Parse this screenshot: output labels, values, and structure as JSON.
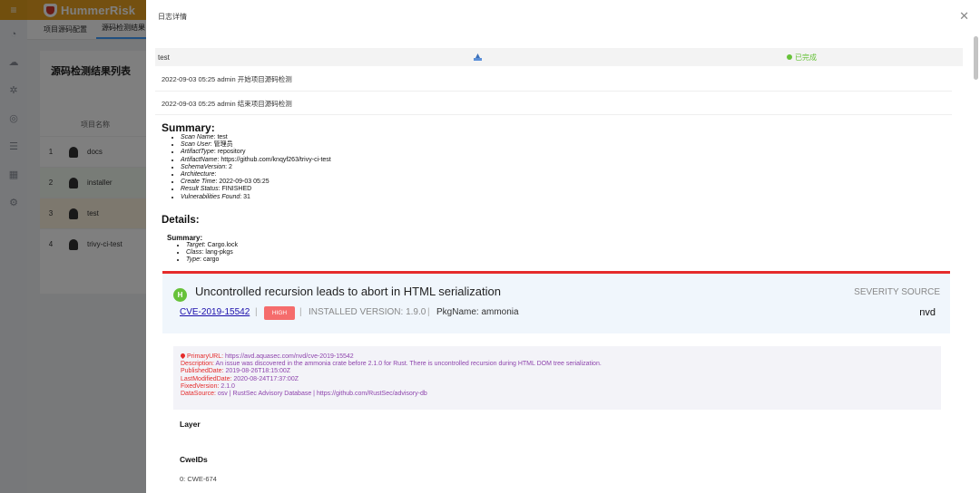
{
  "app": {
    "brand": "HummerRisk",
    "tabs": [
      "项目源码配置",
      "源码检测结果"
    ],
    "card_title": "源码检测结果列表",
    "table_header": "项目名称",
    "rows": [
      {
        "index": "1",
        "name": "docs"
      },
      {
        "index": "2",
        "name": "installer"
      },
      {
        "index": "3",
        "name": "test"
      },
      {
        "index": "4",
        "name": "trivy-ci-test"
      }
    ]
  },
  "drawer": {
    "title": "日志详情",
    "log": {
      "name": "test",
      "status": "已完成",
      "lines": [
        "2022-09-03 05:25 admin 开始项目源码检测",
        "2022-09-03 05:25 admin 结束项目源码检测"
      ]
    },
    "summary": {
      "heading": "Summary:",
      "items": [
        {
          "k": "Scan Name",
          "v": "test"
        },
        {
          "k": "Scan User",
          "v": "管理员"
        },
        {
          "k": "ArtifactType",
          "v": "repository"
        },
        {
          "k": "ArtifactName",
          "v": "https://github.com/knqyf263/trivy-ci-test"
        },
        {
          "k": "SchemaVersion",
          "v": "2"
        },
        {
          "k": "Architecture",
          "v": ""
        },
        {
          "k": "Create Time",
          "v": "2022-09-03 05:25"
        },
        {
          "k": "Result Status",
          "v": "FINISHED"
        },
        {
          "k": "Vulnerabilities Found",
          "v": "31"
        }
      ]
    },
    "details": {
      "heading": "Details:",
      "sub_heading": "Summary:",
      "items": [
        {
          "k": "Target",
          "v": "Cargo.lock"
        },
        {
          "k": "Class",
          "v": "lang-pkgs"
        },
        {
          "k": "Type",
          "v": "cargo"
        }
      ]
    },
    "vuln": {
      "badge": "H",
      "title": "Uncontrolled recursion leads to abort in HTML serialization",
      "severity_source_label": "SEVERITY SOURCE",
      "cve": "CVE-2019-15542",
      "severity": "HIGH",
      "installed_version": "INSTALLED VERSION: 1.9.0",
      "pkg_name": "PkgName: ammonia",
      "severity_source": "nvd",
      "primary_url_k": "PrimaryURL:",
      "primary_url_v": "https://avd.aquasec.com/nvd/cve-2019-15542",
      "description_k": "Description:",
      "description_v": "An issue was discovered in the ammonia crate before 2.1.0 for Rust. There is uncontrolled recursion during HTML DOM tree serialization.",
      "published_k": "PublishedDate:",
      "published_v": "2019-08-26T18:15:00Z",
      "modified_k": "LastModifiedDate:",
      "modified_v": "2020-08-24T17:37:00Z",
      "fixed_k": "FixedVersion:",
      "fixed_v": "2.1.0",
      "datasource_k": "DataSource:",
      "datasource_v": "osv | RustSec Advisory Database | https://github.com/RustSec/advisory-db",
      "layer_heading": "Layer",
      "cwe_heading": "CweIDs",
      "cwe_item": "0:  CWE-674"
    }
  }
}
